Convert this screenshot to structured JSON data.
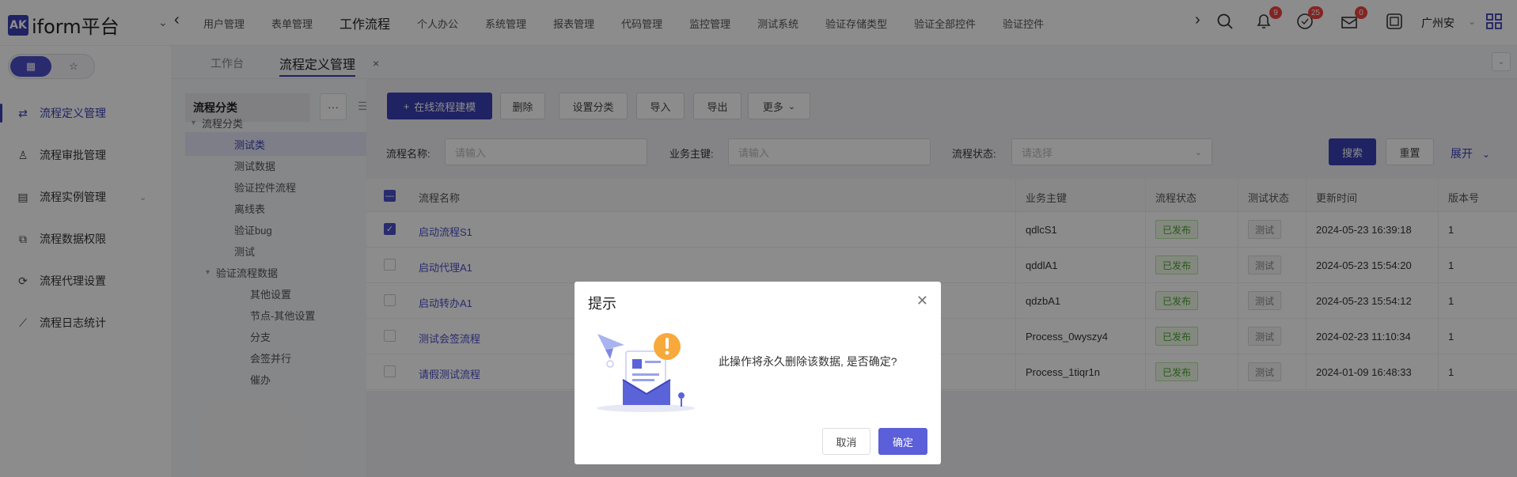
{
  "app": {
    "logo_mark": "AK",
    "title": "iform平台"
  },
  "header": {
    "nav": [
      "用户管理",
      "表单管理",
      "工作流程",
      "个人办公",
      "系统管理",
      "报表管理",
      "代码管理",
      "监控管理",
      "测试系统",
      "验证存储类型",
      "验证全部控件",
      "验证控件"
    ],
    "active_nav": "工作流程",
    "badges": {
      "bell": "9",
      "messages": "25",
      "mail": "0"
    },
    "region": "广州安"
  },
  "sidebar": {
    "toggle": {
      "grid": "grid-icon",
      "star": "star-icon"
    },
    "items": [
      {
        "label": "流程定义管理",
        "icon": "flow-icon",
        "active": true
      },
      {
        "label": "流程审批管理",
        "icon": "approve-icon"
      },
      {
        "label": "流程实例管理",
        "icon": "instance-icon"
      },
      {
        "label": "流程数据权限",
        "icon": "permission-icon"
      },
      {
        "label": "流程代理设置",
        "icon": "proxy-icon"
      },
      {
        "label": "流程日志统计",
        "icon": "chart-icon"
      }
    ]
  },
  "tabs": [
    {
      "label": "工作台"
    },
    {
      "label": "流程定义管理",
      "active": true
    }
  ],
  "category": {
    "title": "流程分类",
    "more": "···",
    "tree": [
      {
        "label": "流程分类",
        "level": 0,
        "expanded": true
      },
      {
        "label": "测试类",
        "level": 1,
        "selected": true
      },
      {
        "label": "测试数据",
        "level": 1
      },
      {
        "label": "验证控件流程",
        "level": 1
      },
      {
        "label": "离线表",
        "level": 1
      },
      {
        "label": "验证bug",
        "level": 1
      },
      {
        "label": "测试",
        "level": 1
      },
      {
        "label": "验证流程数据",
        "level": 1,
        "expanded": true
      },
      {
        "label": "其他设置",
        "level": 2
      },
      {
        "label": "节点-其他设置",
        "level": 2
      },
      {
        "label": "分支",
        "level": 2
      },
      {
        "label": "会签并行",
        "level": 2
      },
      {
        "label": "催办",
        "level": 2
      }
    ]
  },
  "toolbar": {
    "create": "在线流程建模",
    "delete": "删除",
    "set_category": "设置分类",
    "import": "导入",
    "export": "导出",
    "more": "更多"
  },
  "filter": {
    "name_label": "流程名称:",
    "name_placeholder": "请输入",
    "key_label": "业务主键:",
    "key_placeholder": "请输入",
    "status_label": "流程状态:",
    "status_placeholder": "请选择",
    "search": "搜索",
    "reset": "重置",
    "expand": "展开"
  },
  "table": {
    "columns": [
      "流程名称",
      "业务主键",
      "流程状态",
      "测试状态",
      "更新时间",
      "版本号"
    ],
    "rows": [
      {
        "name": "启动流程S1",
        "key": "qdlcS1",
        "status": "已发布",
        "test": "测试",
        "updated": "2024-05-23 16:39:18",
        "version": "1",
        "checked": true
      },
      {
        "name": "启动代理A1",
        "key": "qddlA1",
        "status": "已发布",
        "test": "测试",
        "updated": "2024-05-23 15:54:20",
        "version": "1"
      },
      {
        "name": "启动转办A1",
        "key": "qdzbA1",
        "status": "已发布",
        "test": "测试",
        "updated": "2024-05-23 15:54:12",
        "version": "1"
      },
      {
        "name": "测试会签流程",
        "key": "Process_0wyszy4",
        "status": "已发布",
        "test": "测试",
        "updated": "2024-02-23 11:10:34",
        "version": "1"
      },
      {
        "name": "请假测试流程",
        "key": "Process_1tiqr1n",
        "status": "已发布",
        "test": "测试",
        "updated": "2024-01-09 16:48:33",
        "version": "1"
      }
    ]
  },
  "dialog": {
    "title": "提示",
    "message": "此操作将永久删除该数据, 是否确定?",
    "cancel": "取消",
    "confirm": "确定"
  },
  "colors": {
    "primary": "#3a3fb5",
    "published": "#4aa52e",
    "badge": "#f0433f"
  }
}
